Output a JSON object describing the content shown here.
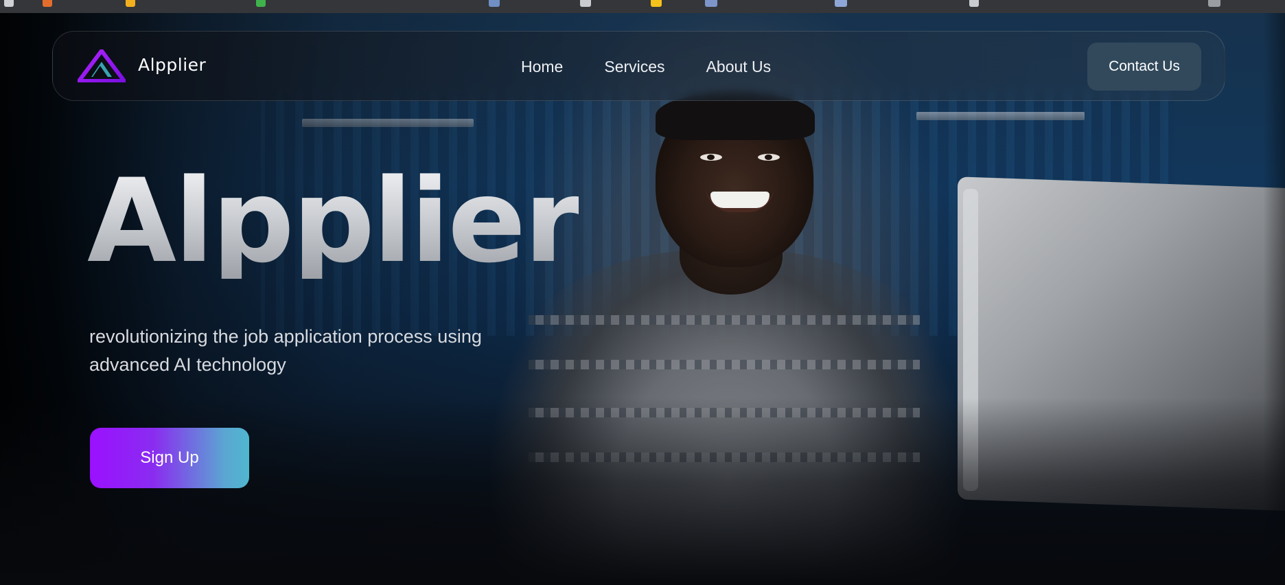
{
  "navbar": {
    "logo_icon": "triangle-logo-icon",
    "brand": "Alpplier",
    "links": [
      "Home",
      "Services",
      "About Us"
    ],
    "contact_label": "Contact Us"
  },
  "hero": {
    "title": "Alpplier",
    "subtitle": "revolutionizing the job application process using advanced AI technology",
    "signup_label": "Sign Up"
  },
  "colors": {
    "accent_purple": "#9b10ff",
    "accent_teal": "#4fb7cf",
    "contact_button": "#32495c"
  }
}
